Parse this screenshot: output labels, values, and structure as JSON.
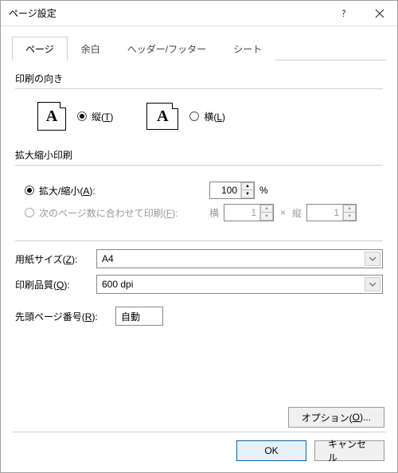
{
  "title": "ページ設定",
  "tabs": {
    "page": "ページ",
    "margins": "余白",
    "headerfooter": "ヘッダー/フッター",
    "sheet": "シート"
  },
  "orientation": {
    "group": "印刷の向き",
    "portrait_pre": "縦(",
    "portrait_u": "T",
    "portrait_post": ")",
    "landscape_pre": "横(",
    "landscape_u": "L",
    "landscape_post": ")"
  },
  "scaling": {
    "group": "拡大縮小印刷",
    "adjust_pre": "拡大/縮小(",
    "adjust_u": "A",
    "adjust_post": "):",
    "adjust_value": "100",
    "percent": "%",
    "fit_pre": "次のページ数に合わせて印刷(",
    "fit_u": "F",
    "fit_post": "):",
    "fit_wide_label": "横",
    "fit_wide_value": "1",
    "times": "×",
    "fit_tall_label": "縦",
    "fit_tall_value": "1"
  },
  "paper": {
    "size_pre": "用紙サイズ(",
    "size_u": "Z",
    "size_post": "):",
    "size_value": "A4",
    "quality_pre": "印刷品質(",
    "quality_u": "Q",
    "quality_post": "):",
    "quality_value": "600 dpi"
  },
  "firstpage": {
    "pre": "先頭ページ番号(",
    "u": "R",
    "post": "):",
    "value": "自動"
  },
  "options": {
    "pre": "オプション(",
    "u": "O",
    "post": ")..."
  },
  "buttons": {
    "ok": "OK",
    "cancel": "キャンセル"
  }
}
